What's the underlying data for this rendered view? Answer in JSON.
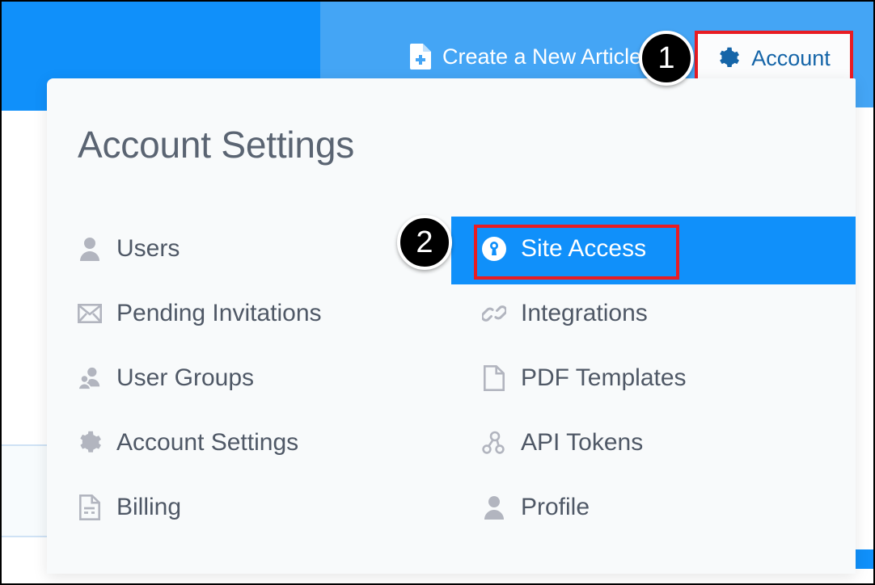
{
  "header": {
    "create_article_label": "Create a New Article",
    "create_article_icon": "document-plus-icon",
    "account_label": "Account",
    "account_icon": "gear-icon",
    "bar_color_left": "#1090fa",
    "bar_color_right": "#44a5f5"
  },
  "panel": {
    "title": "Account Settings",
    "background": "#f8fafb",
    "menu": [
      {
        "left": {
          "label": "Users",
          "icon": "user-icon",
          "selected": false
        },
        "right": {
          "label": "Site Access",
          "icon": "lock-icon",
          "selected": true
        }
      },
      {
        "left": {
          "label": "Pending Invitations",
          "icon": "envelope-icon",
          "selected": false
        },
        "right": {
          "label": "Integrations",
          "icon": "link-icon",
          "selected": false
        }
      },
      {
        "left": {
          "label": "User Groups",
          "icon": "users-group-icon",
          "selected": false
        },
        "right": {
          "label": "PDF Templates",
          "icon": "file-icon",
          "selected": false
        }
      },
      {
        "left": {
          "label": "Account Settings",
          "icon": "gear-icon",
          "selected": false
        },
        "right": {
          "label": "API Tokens",
          "icon": "api-nodes-icon",
          "selected": false
        }
      },
      {
        "left": {
          "label": "Billing",
          "icon": "invoice-icon",
          "selected": false
        },
        "right": {
          "label": "Profile",
          "icon": "user-icon",
          "selected": false
        }
      }
    ]
  },
  "annotations": {
    "highlight_color": "#e81c23",
    "selected_row_color": "#1090fa",
    "badges": [
      {
        "number": "1",
        "target": "Account"
      },
      {
        "number": "2",
        "target": "Site Access"
      }
    ]
  }
}
